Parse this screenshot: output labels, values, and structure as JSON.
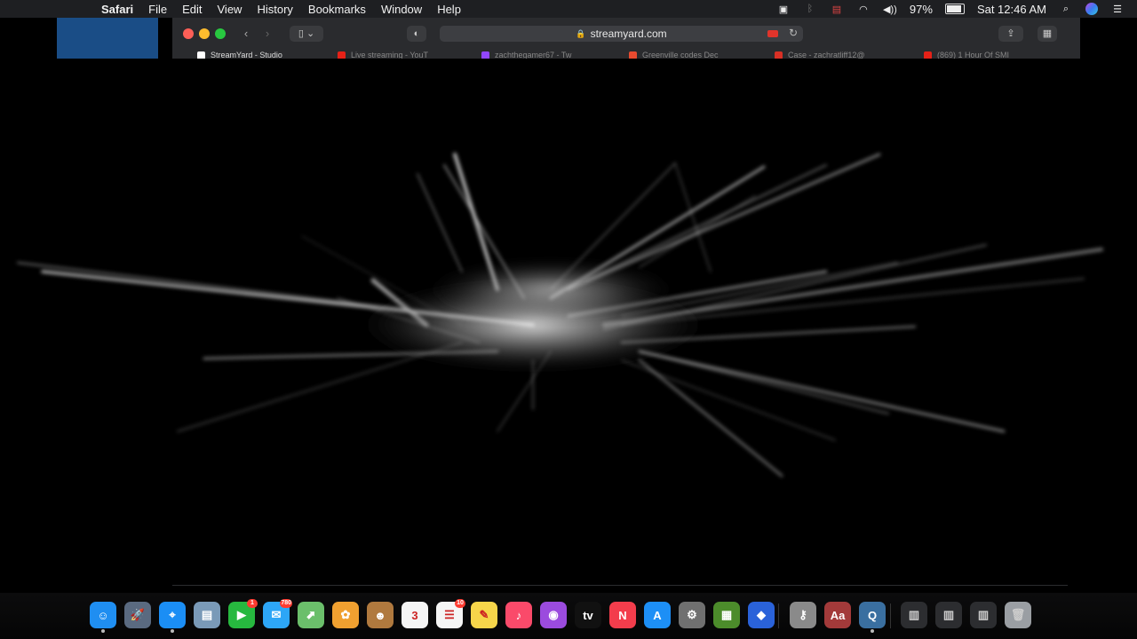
{
  "menubar": {
    "apple_icon": "apple-logo-icon",
    "app_name": "Safari",
    "items": [
      "File",
      "Edit",
      "View",
      "History",
      "Bookmarks",
      "Window",
      "Help"
    ],
    "battery_percent": "97%",
    "battery_level": 0.97,
    "clock": "Sat 12:46 AM",
    "status_icons": [
      "screen-mirroring-icon",
      "bluetooth-icon",
      "flag-us-icon",
      "wifi-icon",
      "volume-icon"
    ]
  },
  "browser": {
    "url": "streamyard.com",
    "tabs": [
      {
        "label": "StreamYard - Studio",
        "color": "#ffffff",
        "active": true
      },
      {
        "label": "Live streaming - YouT",
        "color": "#e62117"
      },
      {
        "label": "zachthegamer67 - Tw",
        "color": "#9146ff"
      },
      {
        "label": "Greenville codes Dec",
        "color": "#e84a2f"
      },
      {
        "label": "Case - zachratliff12@",
        "color": "#d93025"
      },
      {
        "label": "(869) 1 Hour Of SMI",
        "color": "#e62117"
      }
    ]
  },
  "dock": {
    "apps": [
      {
        "name": "finder",
        "glyph": "☺",
        "color": "#1f8ef1",
        "running": true
      },
      {
        "name": "launchpad",
        "glyph": "🚀",
        "color": "#5a6a80"
      },
      {
        "name": "safari",
        "glyph": "⌖",
        "color": "#1b8ef5",
        "running": true
      },
      {
        "name": "preview",
        "glyph": "▤",
        "color": "#7a9ab8"
      },
      {
        "name": "facetime",
        "glyph": "▶",
        "color": "#27b83f",
        "badge": "1"
      },
      {
        "name": "messages",
        "glyph": "✉",
        "color": "#2da6f7",
        "badge": "780"
      },
      {
        "name": "maps",
        "glyph": "⬈",
        "color": "#6bbf6b"
      },
      {
        "name": "photos",
        "glyph": "✿",
        "color": "#f0a030"
      },
      {
        "name": "contacts",
        "glyph": "☻",
        "color": "#b0793e"
      },
      {
        "name": "calendar",
        "glyph": "3",
        "color": "#f5f5f5"
      },
      {
        "name": "reminders",
        "glyph": "☰",
        "color": "#f5f5f5",
        "badge": "10"
      },
      {
        "name": "notes",
        "glyph": "✎",
        "color": "#f6d54a"
      },
      {
        "name": "music",
        "glyph": "♪",
        "color": "#fa4a6a"
      },
      {
        "name": "podcasts",
        "glyph": "◉",
        "color": "#9b4bde"
      },
      {
        "name": "apple-tv",
        "glyph": "tv",
        "color": "#111111"
      },
      {
        "name": "news",
        "glyph": "N",
        "color": "#f33d4c"
      },
      {
        "name": "app-store",
        "glyph": "A",
        "color": "#1d8ff6"
      },
      {
        "name": "system-preferences",
        "glyph": "⚙",
        "color": "#707070"
      },
      {
        "name": "minecraft",
        "glyph": "▦",
        "color": "#4c8c2b"
      },
      {
        "name": "roblox-studio",
        "glyph": "◆",
        "color": "#2a62d9"
      },
      {
        "name": "keychain",
        "glyph": "⚷",
        "color": "#8a8a8a"
      },
      {
        "name": "dictionary",
        "glyph": "Aa",
        "color": "#a33a3a"
      },
      {
        "name": "quicktime",
        "glyph": "Q",
        "color": "#3a6fa0",
        "running": true
      }
    ],
    "stacks": [
      "downloads-stack",
      "documents-stack",
      "screenshots-stack",
      "trash"
    ]
  }
}
